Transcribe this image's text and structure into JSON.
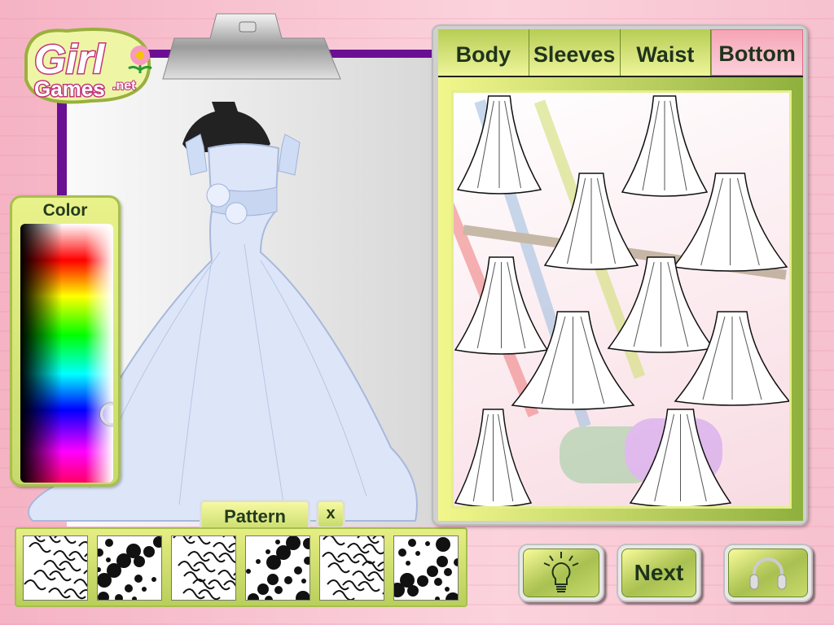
{
  "logo": {
    "text_line1": "Girl",
    "text_line2": "Games",
    "suffix": ".net"
  },
  "color_panel": {
    "title": "Color",
    "selected_hue": "blue",
    "selected_position_fraction": 0.63
  },
  "pattern": {
    "tab_label": "Pattern",
    "close_label": "x",
    "swatches": [
      "swirl-floral",
      "black-floral",
      "scattered-flowers",
      "dense-flowers",
      "curly-vines",
      "baroque-scroll"
    ]
  },
  "tabs": [
    {
      "label": "Body",
      "active": false
    },
    {
      "label": "Sleeves",
      "active": false
    },
    {
      "label": "Waist",
      "active": false
    },
    {
      "label": "Bottom",
      "active": true
    }
  ],
  "buttons": {
    "hint_icon": "lightbulb-icon",
    "next_label": "Next",
    "sound_icon": "headphones-icon"
  },
  "colors": {
    "frame": "#6a0f93",
    "panel_green": "#c6da6a",
    "active_tab": "#f6a5b5",
    "dress": "#dde6f8"
  }
}
